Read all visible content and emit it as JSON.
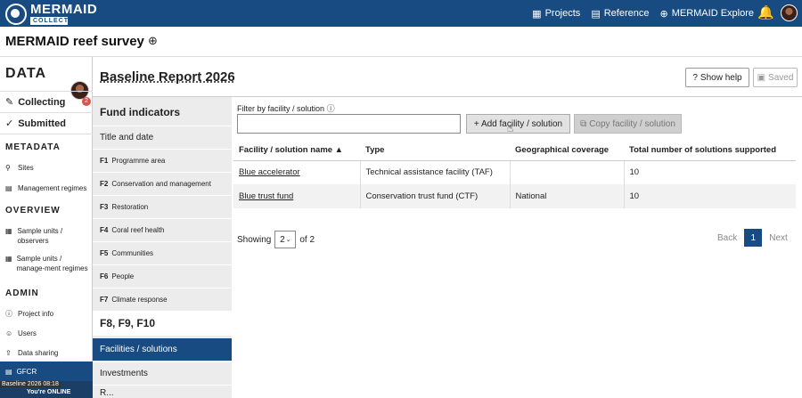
{
  "topbar": {
    "logo_title": "MERMAID",
    "logo_sub": "COLLECT",
    "nav": [
      {
        "icon": "projects-icon",
        "label": "Projects"
      },
      {
        "icon": "reference-icon",
        "label": "Reference"
      },
      {
        "icon": "globe-icon",
        "label": "MERMAID Explore"
      }
    ]
  },
  "project": {
    "title": "MERMAID reef survey"
  },
  "sidebar": {
    "data_label": "DATA",
    "collecting": "Collecting",
    "collecting_count": "2",
    "submitted": "Submitted",
    "metadata_label": "METADATA",
    "metadata_items": [
      "Sites",
      "Management regimes"
    ],
    "overview_label": "OVERVIEW",
    "overview_items": [
      "Sample units / observers",
      "Sample units / manage-ment regimes"
    ],
    "admin_label": "ADMIN",
    "admin_items": [
      "Project info",
      "Users",
      "Data sharing"
    ],
    "gfcr": "GFCR",
    "online_tip": "Baseline 2026 08:18",
    "online_text": "You're ONLINE"
  },
  "report": {
    "title": "Baseline  Report  2026",
    "help_label": "Show help",
    "saved_label": "Saved"
  },
  "fund": {
    "heading": "Fund indicators",
    "title_date": "Title and date",
    "items": [
      {
        "code": "F1",
        "label": "Programme area"
      },
      {
        "code": "F2",
        "label": "Conservation and management"
      },
      {
        "code": "F3",
        "label": "Restoration"
      },
      {
        "code": "F4",
        "label": "Coral reef health"
      },
      {
        "code": "F5",
        "label": "Communities"
      },
      {
        "code": "F6",
        "label": "People"
      },
      {
        "code": "F7",
        "label": "Climate response"
      }
    ],
    "group": "F8, F9, F10",
    "active": "Facilities / solutions",
    "investments": "Investments",
    "cut_item": "R..."
  },
  "filter": {
    "label": "Filter by facility / solution",
    "placeholder": "",
    "add_label": "+ Add facility / solution",
    "copy_label": "Copy facility / solution"
  },
  "table": {
    "headers": [
      "Facility / solution name ▲",
      "Type",
      "Geographical coverage",
      "Total number of solutions supported"
    ],
    "rows": [
      [
        "Blue accelerator",
        "Technical assistance facility (TAF)",
        "",
        "10"
      ],
      [
        "Blue trust fund",
        "Conservation trust fund (CTF)",
        "National",
        "10"
      ]
    ]
  },
  "pagination": {
    "showing": "Showing",
    "page_size": "2",
    "of_text": "of 2",
    "back": "Back",
    "current": "1",
    "next": "Next"
  },
  "colors": {
    "brand": "#174b82",
    "active_bg": "#174b82",
    "panel_bg": "#ececec"
  }
}
